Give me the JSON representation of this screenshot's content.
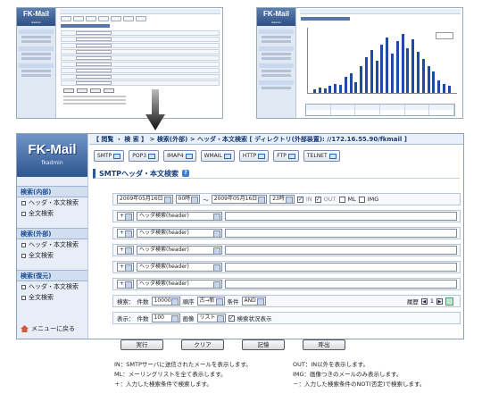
{
  "app": {
    "logo": "FK-Mail",
    "user": "fkadmin"
  },
  "sidebar": {
    "groups": [
      {
        "title": "検索(内部)",
        "items": [
          "ヘッダ・本文検索",
          "全文検索"
        ]
      },
      {
        "title": "検索(外部)",
        "items": [
          "ヘッダ・本文検索",
          "全文検索"
        ]
      },
      {
        "title": "検索(復元)",
        "items": [
          "ヘッダ・本文検索",
          "全文検索"
        ]
      }
    ],
    "back_label": "メニューに戻る"
  },
  "breadcrumb": {
    "text": "【 閲覧 ・ 検 索 】 > 検索(外部) > ヘッダ・本文検索 [ ディレクトリ(外部装置): //172.16.55.90/fkmail ]"
  },
  "toolbar": {
    "buttons": [
      "SMTP",
      "POP3",
      "IMAP4",
      "WMAIL",
      "HTTP",
      "FTP",
      "TELNET"
    ]
  },
  "page": {
    "title": "SMTPヘッダ・本文検索",
    "help_icon": "?"
  },
  "form": {
    "date_from": "2009年05月16日",
    "time_from": "00時",
    "tilde": "〜",
    "date_to": "2009年05月16日",
    "time_to": "23時",
    "check_in": "IN",
    "check_out": "OUT",
    "check_ml": "ML",
    "check_img": "IMG",
    "condition_op": "+",
    "condition_field": "ヘッダ検索(header)",
    "search_label": "検索：",
    "count_label": "件数",
    "count_value": "10000",
    "order_label": "順序",
    "order_value": "古→新",
    "cond_label": "条件",
    "cond_value": "AND",
    "history_label": "履歴",
    "history_nav": "1",
    "display_label": "表示：",
    "display_count_label": "件数",
    "display_count_value": "100",
    "view_label": "画像",
    "view_value": "リスト",
    "show_status_label": "検索状況表示"
  },
  "actions": {
    "run": "実行",
    "clear": "クリア",
    "save": "記憶",
    "recall": "呼出"
  },
  "notes": {
    "in": "IN：SMTPサーバに送信されたメールを表示します。",
    "out": "OUT：IN以外を表示します。",
    "ml": "ML：メーリングリストを全て表示します。",
    "img": "IMG：画像つきのメールのみ表示します。",
    "plus": "＋：入力した検索条件で検索します。",
    "minus": "－：入力した検索条件のNOT(否定)で検索します。"
  },
  "colors": {
    "accent": "#2c5a9c",
    "sidebar_bg": "#e7eef7",
    "chart_bar": "#1f4aa8"
  }
}
